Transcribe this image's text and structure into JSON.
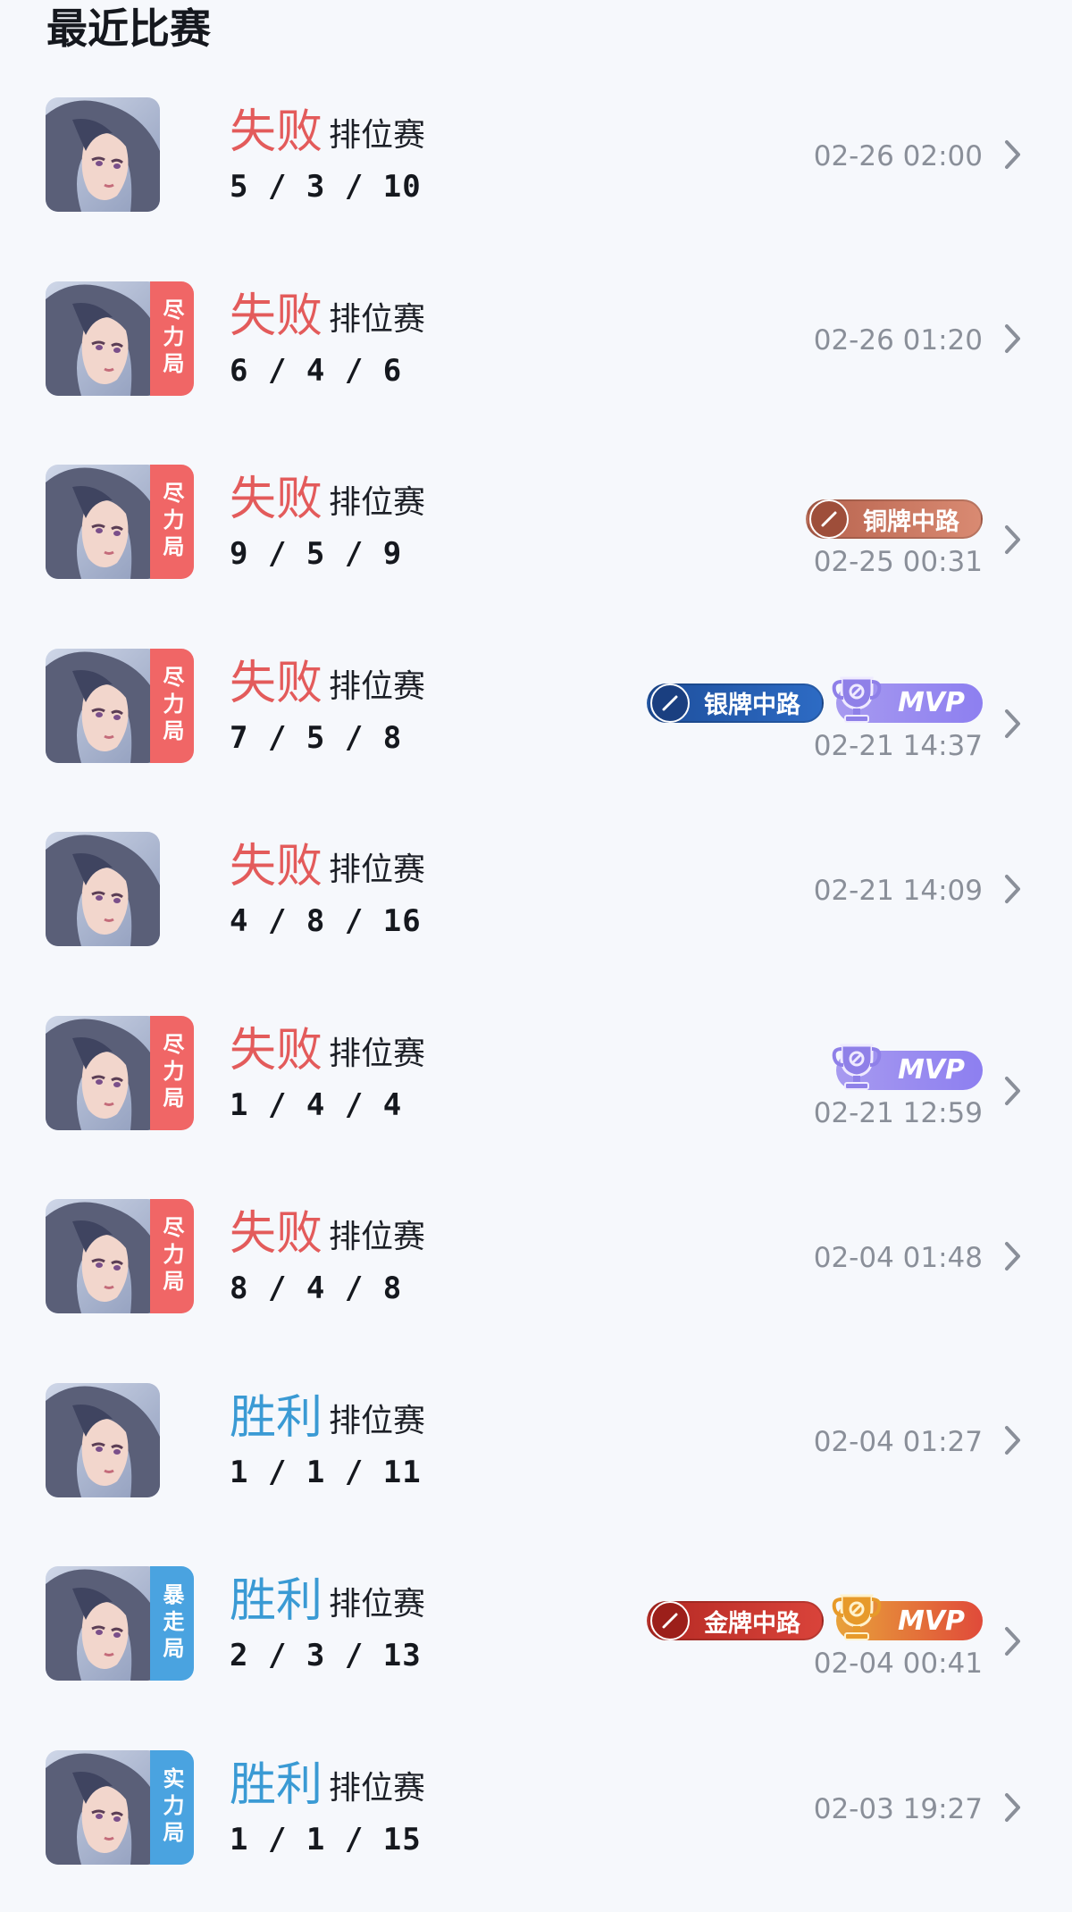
{
  "header": {
    "title": "最近比赛"
  },
  "matches": [
    {
      "result": "失败",
      "win": false,
      "mode": "排位赛",
      "kda": "5 / 3 / 10",
      "time": "02-26 02:00",
      "tag": "",
      "badge": "",
      "mvp": ""
    },
    {
      "result": "失败",
      "win": false,
      "mode": "排位赛",
      "kda": "6 / 4 / 6",
      "time": "02-26 01:20",
      "tag": "尽力局",
      "badge": "",
      "mvp": ""
    },
    {
      "result": "失败",
      "win": false,
      "mode": "排位赛",
      "kda": "9 / 5 / 9",
      "time": "02-25 00:31",
      "tag": "尽力局",
      "badge": "铜牌中路",
      "mvp": ""
    },
    {
      "result": "失败",
      "win": false,
      "mode": "排位赛",
      "kda": "7 / 5 / 8",
      "time": "02-21 14:37",
      "tag": "尽力局",
      "badge": "银牌中路",
      "mvp": "MVP"
    },
    {
      "result": "失败",
      "win": false,
      "mode": "排位赛",
      "kda": "4 / 8 / 16",
      "time": "02-21 14:09",
      "tag": "",
      "badge": "",
      "mvp": ""
    },
    {
      "result": "失败",
      "win": false,
      "mode": "排位赛",
      "kda": "1 / 4 / 4",
      "time": "02-21 12:59",
      "tag": "尽力局",
      "badge": "",
      "mvp": "MVP"
    },
    {
      "result": "失败",
      "win": false,
      "mode": "排位赛",
      "kda": "8 / 4 / 8",
      "time": "02-04 01:48",
      "tag": "尽力局",
      "badge": "",
      "mvp": ""
    },
    {
      "result": "胜利",
      "win": true,
      "mode": "排位赛",
      "kda": "1 / 1 / 11",
      "time": "02-04 01:27",
      "tag": "",
      "badge": "",
      "mvp": ""
    },
    {
      "result": "胜利",
      "win": true,
      "mode": "排位赛",
      "kda": "2 / 3 / 13",
      "time": "02-04 00:41",
      "tag": "暴走局",
      "badge": "金牌中路",
      "mvp": "MVP"
    },
    {
      "result": "胜利",
      "win": true,
      "mode": "排位赛",
      "kda": "1 / 1 / 15",
      "time": "02-03 19:27",
      "tag": "实力局",
      "badge": "",
      "mvp": ""
    }
  ],
  "styles": {
    "lose_color": "#e35b5b",
    "win_color": "#3a9ad4",
    "tag_lose_color": "#f06666",
    "tag_win_color": "#4aa3e0",
    "badge_colors": {
      "铜牌中路": "bronze",
      "银牌中路": "silver",
      "金牌中路": "gold"
    },
    "icons": {
      "avatar": "hero-portrait-icon",
      "chevron": "chevron-right-icon",
      "mvp": "trophy-icon",
      "badge": "lane-sword-icon"
    }
  }
}
